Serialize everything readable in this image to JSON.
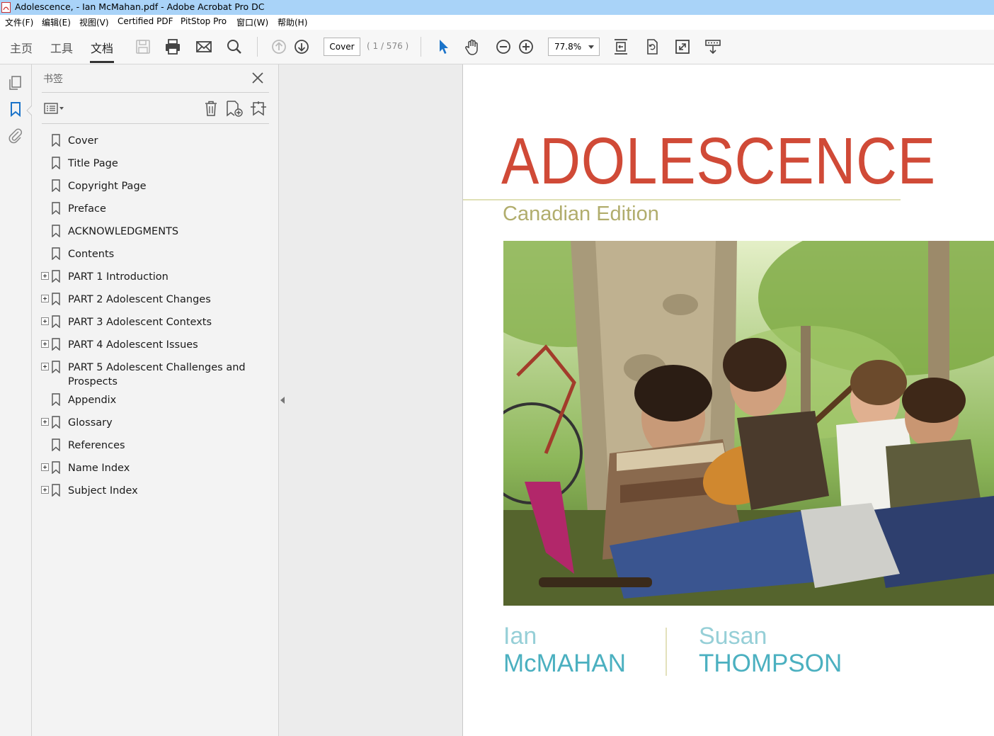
{
  "window": {
    "title": "Adolescence, - Ian McMahan.pdf - Adobe Acrobat Pro DC"
  },
  "menu": [
    "文件(F)",
    "编辑(E)",
    "视图(V)",
    "Certified PDF",
    "PitStop Pro",
    "窗口(W)",
    "帮助(H)"
  ],
  "tabs": {
    "home": "主页",
    "tools": "工具",
    "document": "文档"
  },
  "nav": {
    "page_label": "Cover",
    "page_count": "( 1 / 576 )"
  },
  "zoom": {
    "value": "77.8%"
  },
  "bookmarks_panel": {
    "title": "书签",
    "items": [
      {
        "label": "Cover",
        "expandable": false
      },
      {
        "label": "Title Page",
        "expandable": false
      },
      {
        "label": "Copyright Page",
        "expandable": false
      },
      {
        "label": "Preface",
        "expandable": false
      },
      {
        "label": "ACKNOWLEDGMENTS",
        "expandable": false
      },
      {
        "label": "Contents",
        "expandable": false
      },
      {
        "label": "PART 1 Introduction",
        "expandable": true
      },
      {
        "label": "PART 2 Adolescent Changes",
        "expandable": true
      },
      {
        "label": "PART 3 Adolescent Contexts",
        "expandable": true
      },
      {
        "label": "PART 4 Adolescent Issues",
        "expandable": true
      },
      {
        "label": "PART 5 Adolescent Challenges and Prospects",
        "expandable": true
      },
      {
        "label": "Appendix",
        "expandable": false
      },
      {
        "label": "Glossary",
        "expandable": true
      },
      {
        "label": "References",
        "expandable": false
      },
      {
        "label": "Name Index",
        "expandable": true
      },
      {
        "label": "Subject Index",
        "expandable": true
      }
    ]
  },
  "cover": {
    "title": "ADOLESCENCE",
    "subtitle": "Canadian Edition",
    "author1_first": "Ian",
    "author1_last": "McMAHAN",
    "author2_first": "Susan",
    "author2_last": "THOMPSON",
    "colors": {
      "title": "#d04a37",
      "subtitle": "#b1ad6d",
      "authors": "#4bb0c0"
    }
  },
  "icons": [
    "pdf-app-icon",
    "save-icon",
    "print-icon",
    "email-icon",
    "search-icon",
    "prev-page-icon",
    "next-page-icon",
    "select-cursor-icon",
    "hand-icon",
    "zoom-out-icon",
    "zoom-in-icon",
    "fit-page-icon",
    "rotate-icon",
    "fullscreen-icon",
    "read-mode-icon",
    "pages-thumbnail-icon",
    "bookmark-panel-icon",
    "attachment-icon",
    "close-icon",
    "bookmark-options-icon",
    "delete-bookmark-icon",
    "new-bookmark-icon",
    "expand-bookmark-icon"
  ]
}
